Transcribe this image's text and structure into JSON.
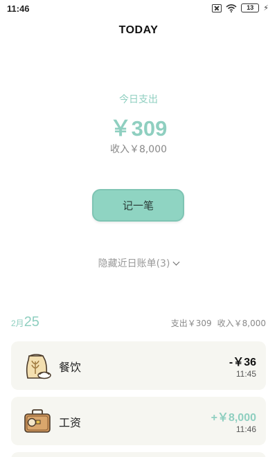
{
  "status_bar": {
    "time": "11:46",
    "battery": "13",
    "icons": [
      "sim-off-icon",
      "wifi-icon",
      "battery-icon",
      "charging-icon"
    ]
  },
  "header": {
    "title": "TODAY"
  },
  "summary": {
    "spend_label": "今日支出",
    "spend_amount": "￥309",
    "income_line": "收入￥8,000"
  },
  "record_button": {
    "label": "记一笔"
  },
  "toggle": {
    "label": "隐藏近日账单(3)",
    "icon": "chevron-down-icon"
  },
  "day": {
    "month": "2月",
    "day": "25",
    "expense": "支出￥309",
    "income": "收入￥8,000"
  },
  "records": [
    {
      "category": "餐饮",
      "amount": "-￥36",
      "time": "11:45",
      "icon": "flour-bag-icon",
      "type": "expense"
    },
    {
      "category": "工资",
      "amount": "+￥8,000",
      "time": "11:46",
      "icon": "briefcase-icon",
      "type": "income"
    }
  ],
  "colors": {
    "accent": "#8fcfc0",
    "button": "#8fd4c2",
    "card_bg": "#f6f6f1"
  }
}
